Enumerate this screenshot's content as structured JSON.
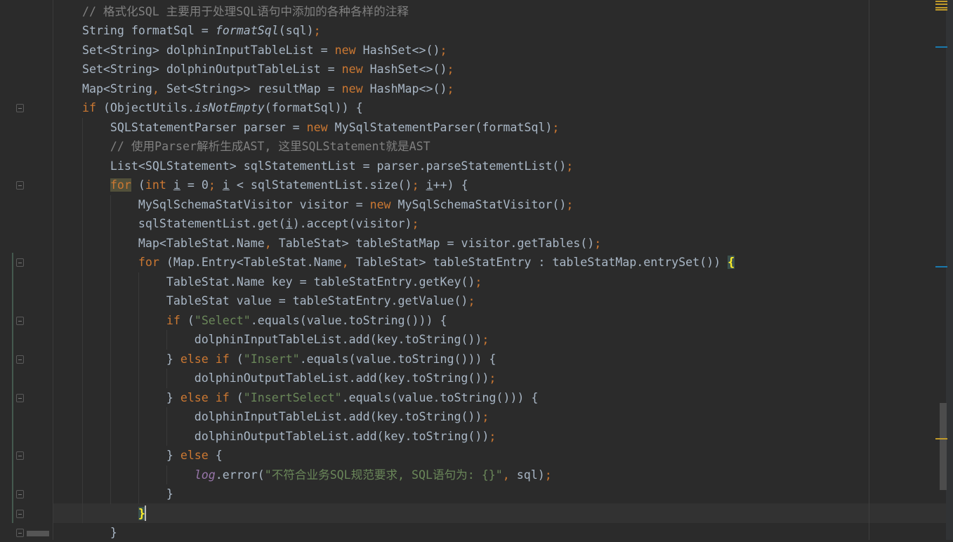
{
  "colors": {
    "keyword": "#cc7832",
    "string": "#6a8759",
    "comment": "#808080",
    "text": "#a9b7c6",
    "static": "#9876aa"
  },
  "code": [
    [
      [
        "    // 格式化SQL 主要用于处理SQL语句中添加的各种各样的注释",
        "cm"
      ]
    ],
    [
      [
        "    String formatSql = ",
        ""
      ],
      [
        "formatSql",
        "it"
      ],
      [
        "(sql)",
        ""
      ],
      [
        ";",
        "kw"
      ]
    ],
    [
      [
        "    Set<String> dolphinInputTableList = ",
        ""
      ],
      [
        "new",
        "kw"
      ],
      [
        " HashSet<>()",
        ""
      ],
      [
        ";",
        "kw"
      ]
    ],
    [
      [
        "    Set<String> dolphinOutputTableList = ",
        ""
      ],
      [
        "new",
        "kw"
      ],
      [
        " HashSet<>()",
        ""
      ],
      [
        ";",
        "kw"
      ]
    ],
    [
      [
        "    Map<String",
        ""
      ],
      [
        ",",
        "kw"
      ],
      [
        " Set<String>> resultMap = ",
        ""
      ],
      [
        "new",
        "kw"
      ],
      [
        " HashMap<>()",
        ""
      ],
      [
        ";",
        "kw"
      ]
    ],
    [
      [
        "    ",
        ""
      ],
      [
        "if",
        "kw"
      ],
      [
        " (ObjectUtils.",
        ""
      ],
      [
        "isNotEmpty",
        "it"
      ],
      [
        "(formatSql)) {",
        ""
      ]
    ],
    [
      [
        "        SQLStatementParser parser = ",
        ""
      ],
      [
        "new",
        "kw"
      ],
      [
        " MySqlStatementParser(formatSql)",
        ""
      ],
      [
        ";",
        "kw"
      ]
    ],
    [
      [
        "        // 使用Parser解析生成AST, 这里SQLStatement就是AST",
        "cm"
      ]
    ],
    [
      [
        "        List<SQLStatement> sqlStatementList = parser.parseStatementList()",
        ""
      ],
      [
        ";",
        "kw"
      ]
    ],
    [
      [
        "        ",
        ""
      ],
      [
        "for",
        "kw hl"
      ],
      [
        " (",
        ""
      ],
      [
        "int",
        "kw"
      ],
      [
        " ",
        ""
      ],
      [
        "i",
        "u"
      ],
      [
        " = ",
        ""
      ],
      [
        "0",
        "num"
      ],
      [
        ";",
        "kw"
      ],
      [
        " ",
        ""
      ],
      [
        "i",
        "u"
      ],
      [
        " < sqlStatementList.size()",
        ""
      ],
      [
        ";",
        "kw"
      ],
      [
        " ",
        ""
      ],
      [
        "i",
        "u"
      ],
      [
        "++) {",
        ""
      ]
    ],
    [
      [
        "            MySqlSchemaStatVisitor visitor = ",
        ""
      ],
      [
        "new",
        "kw"
      ],
      [
        " MySqlSchemaStatVisitor()",
        ""
      ],
      [
        ";",
        "kw"
      ]
    ],
    [
      [
        "            sqlStatementList.get(",
        ""
      ],
      [
        "i",
        "u"
      ],
      [
        ").accept(visitor)",
        ""
      ],
      [
        ";",
        "kw"
      ]
    ],
    [
      [
        "            Map<TableStat.Name",
        ""
      ],
      [
        ",",
        "kw"
      ],
      [
        " TableStat> tableStatMap = visitor.getTables()",
        ""
      ],
      [
        ";",
        "kw"
      ]
    ],
    [
      [
        "            ",
        ""
      ],
      [
        "for",
        "kw"
      ],
      [
        " (Map.Entry<TableStat.Name",
        ""
      ],
      [
        ",",
        "kw"
      ],
      [
        " TableStat> tableStatEntry : tableStatMap.entrySet()) ",
        ""
      ],
      [
        "{",
        "br"
      ]
    ],
    [
      [
        "                TableStat.Name key = tableStatEntry.getKey()",
        ""
      ],
      [
        ";",
        "kw"
      ]
    ],
    [
      [
        "                TableStat value = tableStatEntry.getValue()",
        ""
      ],
      [
        ";",
        "kw"
      ]
    ],
    [
      [
        "                ",
        ""
      ],
      [
        "if",
        "kw"
      ],
      [
        " (",
        ""
      ],
      [
        "\"Select\"",
        "str"
      ],
      [
        ".equals(value.toString())) {",
        ""
      ]
    ],
    [
      [
        "                    dolphinInputTableList.add(key.toString())",
        ""
      ],
      [
        ";",
        "kw"
      ]
    ],
    [
      [
        "                } ",
        ""
      ],
      [
        "else if",
        "kw"
      ],
      [
        " (",
        ""
      ],
      [
        "\"Insert\"",
        "str"
      ],
      [
        ".equals(value.toString())) {",
        ""
      ]
    ],
    [
      [
        "                    dolphinOutputTableList.add(key.toString())",
        ""
      ],
      [
        ";",
        "kw"
      ]
    ],
    [
      [
        "                } ",
        ""
      ],
      [
        "else if",
        "kw"
      ],
      [
        " (",
        ""
      ],
      [
        "\"InsertSelect\"",
        "str"
      ],
      [
        ".equals(value.toString())) {",
        ""
      ]
    ],
    [
      [
        "                    dolphinInputTableList.add(key.toString())",
        ""
      ],
      [
        ";",
        "kw"
      ]
    ],
    [
      [
        "                    dolphinOutputTableList.add(key.toString())",
        ""
      ],
      [
        ";",
        "kw"
      ]
    ],
    [
      [
        "                } ",
        ""
      ],
      [
        "else",
        "kw"
      ],
      [
        " {",
        ""
      ]
    ],
    [
      [
        "                    ",
        ""
      ],
      [
        "log",
        "st"
      ],
      [
        ".error(",
        ""
      ],
      [
        "\"不符合业务SQL规范要求, SQL语句为: {}\"",
        "str"
      ],
      [
        ",",
        "kw"
      ],
      [
        " sql)",
        ""
      ],
      [
        ";",
        "kw"
      ]
    ],
    [
      [
        "                }",
        ""
      ]
    ],
    [
      [
        "            ",
        ""
      ],
      [
        "}",
        "br"
      ]
    ],
    [
      [
        "        }",
        ""
      ]
    ]
  ]
}
